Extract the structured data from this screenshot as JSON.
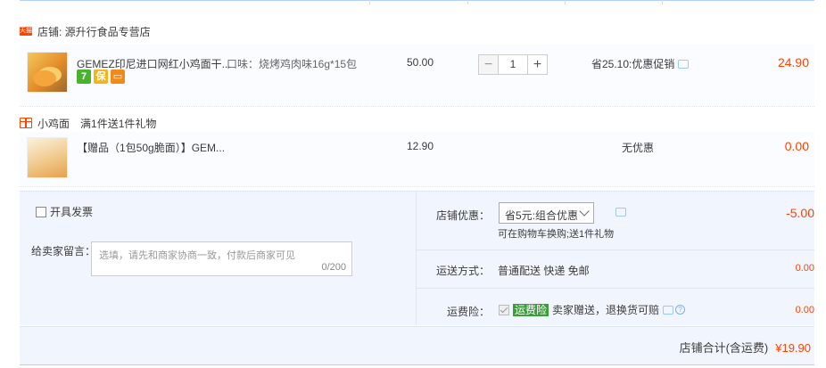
{
  "shop": {
    "name": "店铺: 源升行食品专营店",
    "badge": "天猫"
  },
  "item1": {
    "name": "GEMEZ印尼进口网红小鸡面干...",
    "attr": "口味：烧烤鸡肉味16g*15包",
    "price": "50.00",
    "quantity": "1",
    "minus": "−",
    "plus": "+",
    "promo": "省25.10:优惠促销",
    "subtotal": "24.90",
    "service_icons": [
      "7",
      "保",
      ""
    ]
  },
  "gift": {
    "group": "小鸡面",
    "rule": "满1件送1件礼物",
    "name": "【赠品（1包50g脆面）】GEM...",
    "price": "12.90",
    "promo": "无优惠",
    "subtotal": "0.00"
  },
  "invoice": {
    "label": "开具发票"
  },
  "message": {
    "label": "给卖家留言：",
    "placeholder": "选填，请先和商家协商一致，付款后商家可见",
    "count": "0/200"
  },
  "discount": {
    "label": "店铺优惠：",
    "selected": "省5元:组合优惠",
    "sub": "可在购物车换购;送1件礼物",
    "amount": "-5.00"
  },
  "shipping": {
    "label": "运送方式：",
    "value": "普通配送 快递 免邮",
    "amount": "0.00"
  },
  "insurance": {
    "label": "运费险：",
    "tag": "运费险",
    "text": "卖家赠送，退换货可赔",
    "help": "?",
    "amount": "0.00"
  },
  "total": {
    "label": "店铺合计(含运费)",
    "amount": "¥19.90"
  },
  "colors": {
    "accent": "#ff4400",
    "panel": "#f1f5fd",
    "border": "#b2d1ff"
  }
}
